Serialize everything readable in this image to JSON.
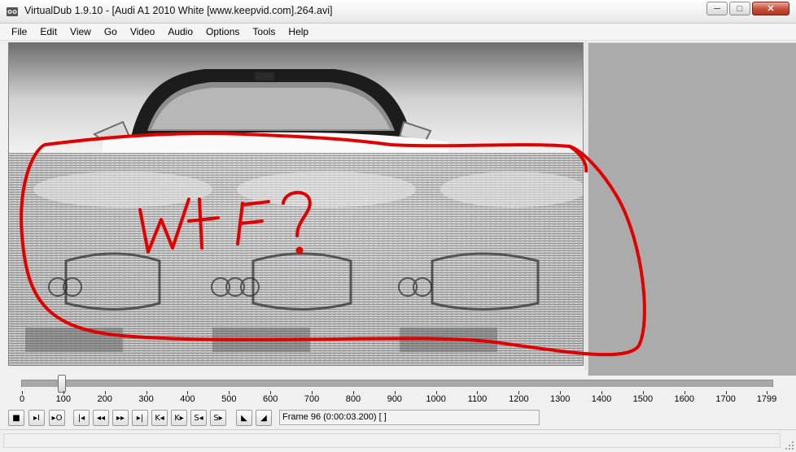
{
  "window": {
    "title": "VirtualDub 1.9.10 - [Audi A1 2010 White [www.keepvid.com].264.avi]",
    "minimize_glyph": "─",
    "maximize_glyph": "□",
    "close_glyph": "✕"
  },
  "menu": [
    "File",
    "Edit",
    "View",
    "Go",
    "Video",
    "Audio",
    "Options",
    "Tools",
    "Help"
  ],
  "video": {
    "annotation_text": "WTF?",
    "annotation_color": "#e00000"
  },
  "timeline": {
    "total_frames": 1799,
    "current_frame": 96,
    "ticks": [
      "0",
      "100",
      "200",
      "300",
      "400",
      "500",
      "600",
      "700",
      "800",
      "900",
      "1000",
      "1100",
      "1200",
      "1300",
      "1400",
      "1500",
      "1600",
      "1700",
      "1799"
    ]
  },
  "toolbar": {
    "buttons": [
      {
        "name": "stop-icon",
        "glyph": "■"
      },
      {
        "name": "play-input-icon",
        "glyph": "▸I"
      },
      {
        "name": "play-output-icon",
        "glyph": "▸O"
      },
      {
        "name": "go-start-icon",
        "glyph": "|◂"
      },
      {
        "name": "prev-frame-icon",
        "glyph": "◂◂"
      },
      {
        "name": "next-frame-icon",
        "glyph": "▸▸"
      },
      {
        "name": "go-end-icon",
        "glyph": "▸|"
      },
      {
        "name": "prev-keyframe-icon",
        "glyph": "K◂"
      },
      {
        "name": "next-keyframe-icon",
        "glyph": "K▸"
      },
      {
        "name": "scene-back-icon",
        "glyph": "S◂"
      },
      {
        "name": "scene-forward-icon",
        "glyph": "S▸"
      },
      {
        "name": "mark-in-icon",
        "glyph": "◣"
      },
      {
        "name": "mark-out-icon",
        "glyph": "◢"
      }
    ],
    "frame_info": "Frame 96 (0:00:03.200) [ ]"
  },
  "colors": {
    "output_pane": "#ababab",
    "annotation": "#e00000"
  }
}
